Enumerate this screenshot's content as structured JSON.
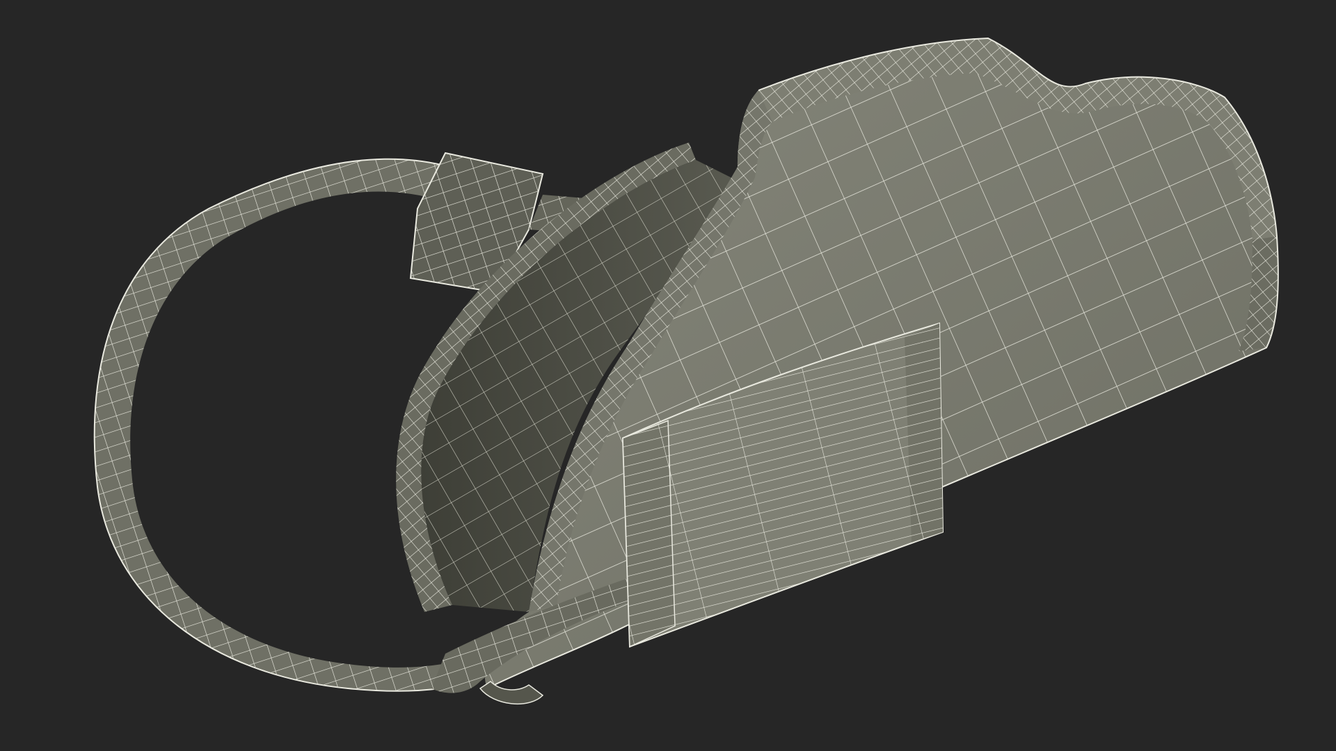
{
  "scene": {
    "subject": "arm-sling-wireframe",
    "render_style": "wireframe"
  },
  "colors": {
    "background": "#262626",
    "surface": "#7a7b70",
    "surface_shadow": "#5f6055",
    "surface_dark": "#4a4b42",
    "wire": "#e9e9df"
  }
}
